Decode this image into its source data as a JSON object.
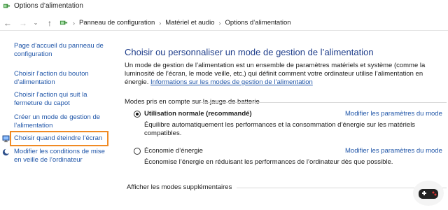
{
  "window": {
    "title": "Options d’alimentation"
  },
  "address": {
    "crumbs": [
      "Panneau de configuration",
      "Matériel et audio",
      "Options d’alimentation"
    ]
  },
  "sidebar": {
    "items": [
      {
        "label": "Page d’accueil du panneau de configuration"
      },
      {
        "label": "Choisir l’action du bouton d’alimentation"
      },
      {
        "label": "Choisir l’action qui suit la fermeture du capot"
      },
      {
        "label": "Créer un mode de gestion de l’alimentation"
      },
      {
        "label": "Choisir quand éteindre l’écran"
      },
      {
        "label": "Modifier les conditions de mise en veille de l’ordinateur"
      }
    ]
  },
  "main": {
    "title": "Choisir ou personnaliser un mode de gestion de l’alimentation",
    "description": "Un mode de gestion de l’alimentation est un ensemble de paramètres matériels et système (comme la luminosité de l’écran, le mode veille, etc.) qui définit comment votre ordinateur utilise l’alimentation en énergie.",
    "description_link": "Informations sur les modes de gestion de l’alimentation",
    "section_label": "Modes pris en compte sur la jauge de batterie",
    "plans": [
      {
        "name": "Utilisation normale (recommandé)",
        "selected": true,
        "link": "Modifier les paramètres du mode",
        "description": "Équilibre automatiquement les performances et la consommation d’énergie sur les matériels compatibles."
      },
      {
        "name": "Économie d’énergie",
        "selected": false,
        "link": "Modifier les paramètres du mode",
        "description": "Économise l’énergie en réduisant les performances de l’ordinateur dès que possible."
      }
    ],
    "more_plans": "Afficher les modes supplémentaires"
  },
  "colors": {
    "link": "#1f55a8",
    "title": "#1e3d8a",
    "highlight": "#f08a24"
  },
  "icons": [
    "power-options-icon",
    "back-arrow-icon",
    "forward-arrow-icon",
    "recent-chevron-icon",
    "up-arrow-icon",
    "control-panel-icon",
    "monitor-icon",
    "moon-sleep-icon"
  ]
}
